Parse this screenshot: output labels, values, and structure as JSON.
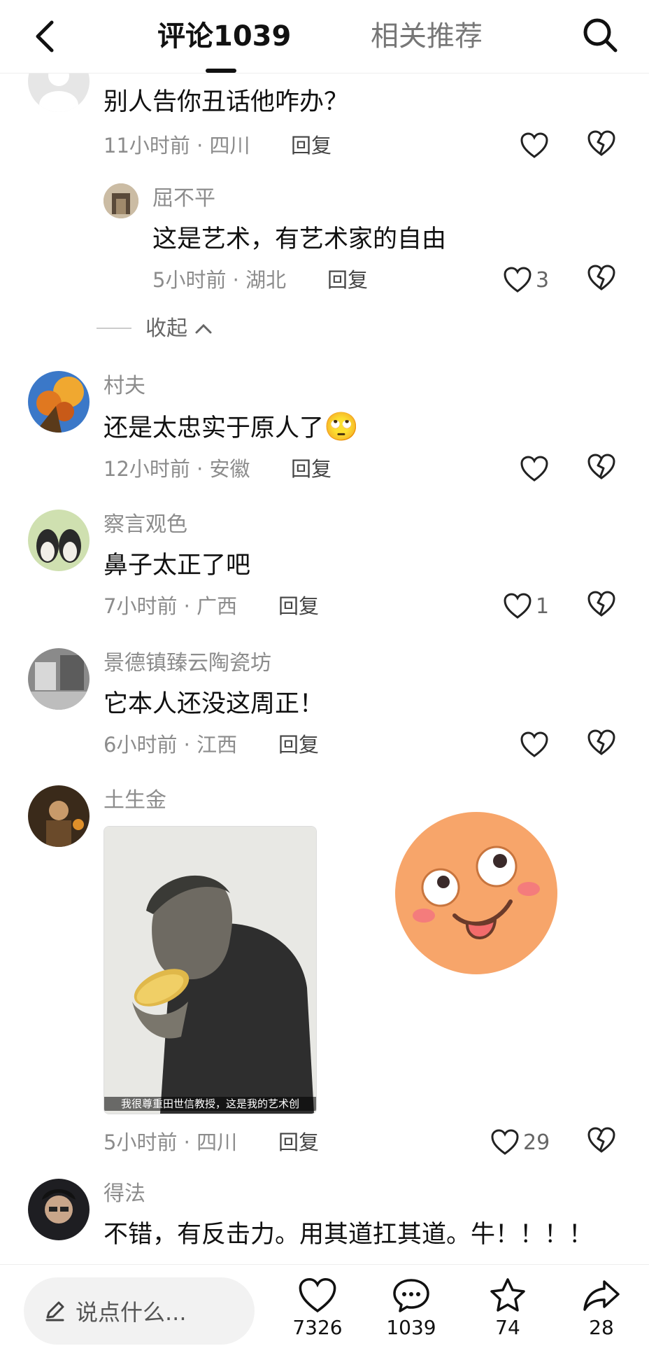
{
  "header": {
    "tab_comments": "评论1039",
    "tab_related": "相关推荐"
  },
  "comments": [
    {
      "username": "",
      "text": "别人告你丑话他咋办？",
      "time": "11小时前 · 四川",
      "reply": "回复",
      "likes": "",
      "replies": [
        {
          "username": "屈不平",
          "text": "这是艺术，有艺术家的自由",
          "time": "5小时前 · 湖北",
          "reply": "回复",
          "likes": "3"
        }
      ],
      "collapse_label": "收起"
    },
    {
      "username": "村夫",
      "text": "还是太忠实于原人了",
      "emoji": "🙄",
      "time": "12小时前 · 安徽",
      "reply": "回复",
      "likes": ""
    },
    {
      "username": "察言观色",
      "text": "鼻子太正了吧",
      "time": "7小时前 · 广西",
      "reply": "回复",
      "likes": "1"
    },
    {
      "username": "景德镇臻云陶瓷坊",
      "text": "它本人还没这周正！",
      "time": "6小时前 · 江西",
      "reply": "回复",
      "likes": ""
    },
    {
      "username": "土生金",
      "image_caption": "我很尊重田世信教授，这是我的艺术创",
      "time": "5小时前 · 四川",
      "reply": "回复",
      "likes": "29"
    },
    {
      "username": "得法",
      "text": "不错，有反击力。用其道扛其道。牛！！！！",
      "time": "",
      "reply": "",
      "likes": ""
    }
  ],
  "bottom_bar": {
    "input_placeholder": "说点什么...",
    "like_count": "7326",
    "comment_count": "1039",
    "favorite_count": "74",
    "share_count": "28"
  },
  "colors": {
    "text_primary": "#111111",
    "text_secondary": "#8c8c8c",
    "sticker_face": "#f7a56a"
  }
}
